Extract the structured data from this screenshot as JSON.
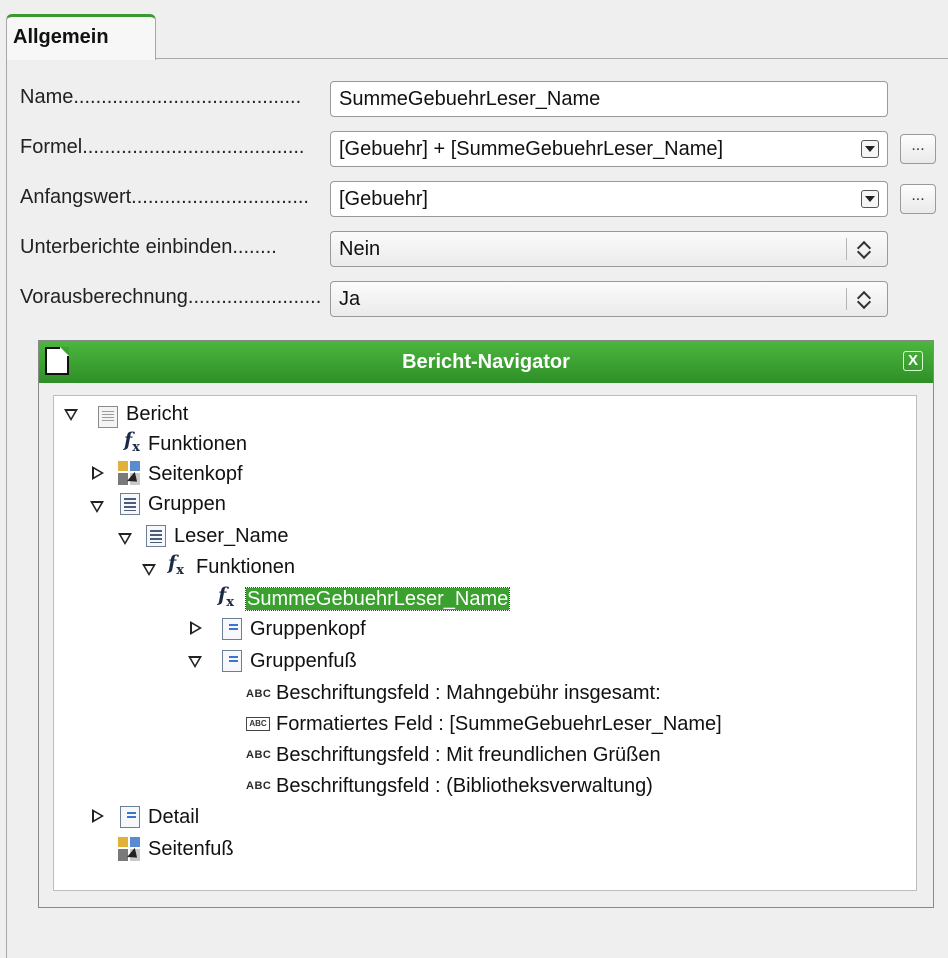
{
  "tab": {
    "label": "Allgemein"
  },
  "form": {
    "rows": [
      {
        "label": "Name.........................................",
        "value": "SummeGebuehrLeser_Name"
      },
      {
        "label": "Formel........................................",
        "value": "[Gebuehr] + [SummeGebuehrLeser_Name]"
      },
      {
        "label": "Anfangswert................................",
        "value": "[Gebuehr]"
      },
      {
        "label": "Unterberichte einbinden........",
        "value": "Nein"
      },
      {
        "label": "Vorausberechnung..........................",
        "value": "Ja"
      }
    ],
    "ellipsis": "..."
  },
  "navigator": {
    "title": "Bericht-Navigator",
    "close_glyph": "X",
    "items": [
      "Bericht",
      "Funktionen",
      "Seitenkopf",
      "Gruppen",
      "Leser_Name",
      "Funktionen",
      "SummeGebuehrLeser_Name",
      "Gruppenkopf",
      "Gruppenfuß",
      "Beschriftungsfeld : Mahngebühr insgesamt:",
      "Formatiertes Feld : [SummeGebuehrLeser_Name]",
      "Beschriftungsfeld : Mit freundlichen Grüßen",
      "Beschriftungsfeld : (Bibliotheksverwaltung)",
      "Detail",
      "Seitenfuß"
    ],
    "fx_glyph": "f",
    "fx_sub": "x",
    "abc_glyph": "ABC"
  }
}
